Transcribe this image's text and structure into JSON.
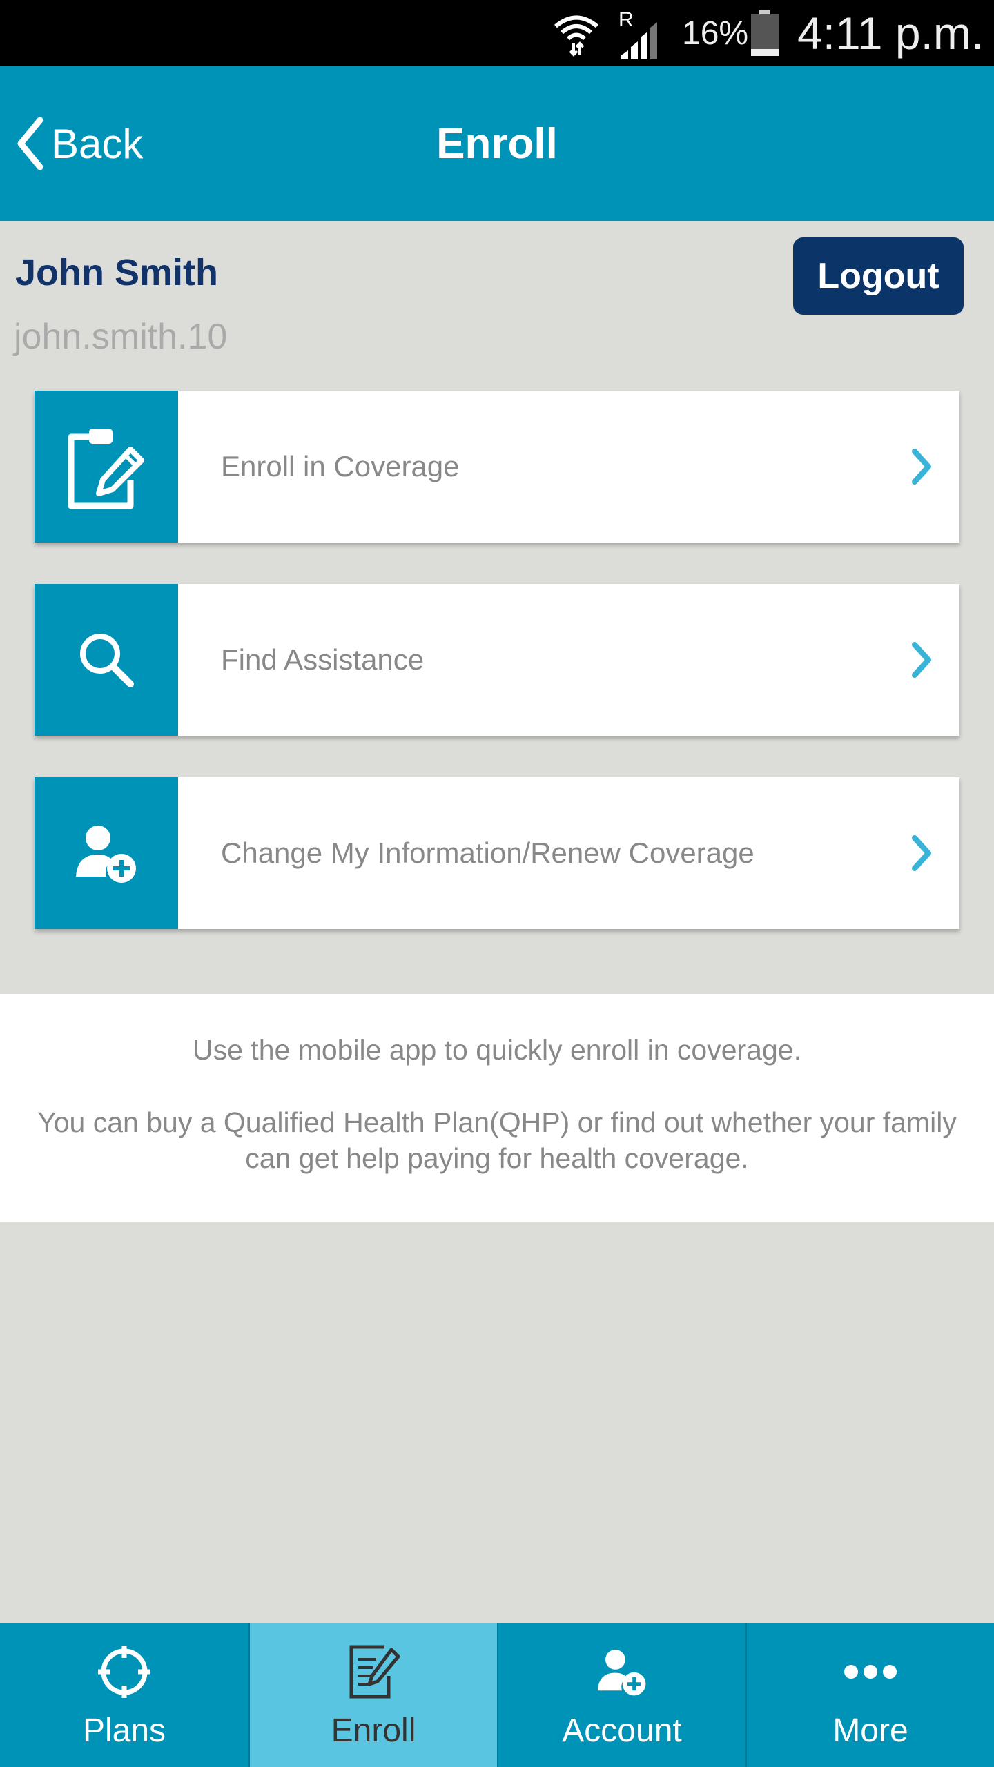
{
  "status_bar": {
    "roaming": "R",
    "battery_percent": "16%",
    "time": "4:11 p.m."
  },
  "header": {
    "back_label": "Back",
    "title": "Enroll"
  },
  "user": {
    "name": "John Smith",
    "username": "john.smith.10",
    "logout_label": "Logout"
  },
  "menu": [
    {
      "label": "Enroll in Coverage",
      "icon": "clipboard-edit-icon"
    },
    {
      "label": "Find Assistance",
      "icon": "search-icon"
    },
    {
      "label": "Change My Information/Renew Coverage",
      "icon": "add-user-icon"
    }
  ],
  "info": {
    "line1": "Use the mobile app to quickly enroll in coverage.",
    "line2": "You can buy a Qualified Health Plan(QHP) or find out whether your family can get help paying for health coverage."
  },
  "tabs": [
    {
      "label": "Plans",
      "icon": "crosshair-icon",
      "active": false
    },
    {
      "label": "Enroll",
      "icon": "document-edit-icon",
      "active": true
    },
    {
      "label": "Account",
      "icon": "add-user-icon",
      "active": false
    },
    {
      "label": "More",
      "icon": "more-dots-icon",
      "active": false
    }
  ],
  "colors": {
    "header_bg": "#0093b8",
    "active_tab_bg": "#5ac5e0",
    "logout_bg": "#0b3468",
    "user_name": "#11336a",
    "chevron": "#3ab3d8",
    "page_bg": "#dcdcd9"
  }
}
